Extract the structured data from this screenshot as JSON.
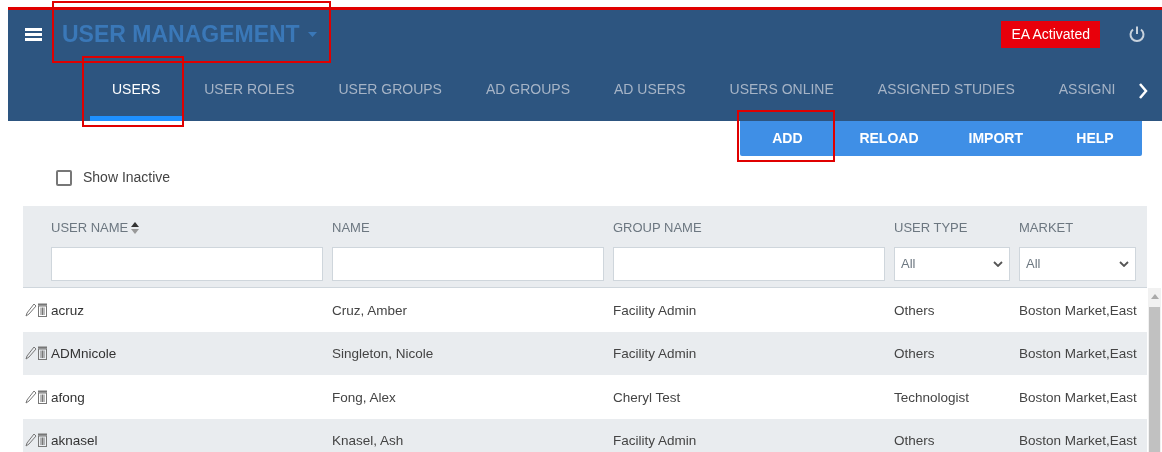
{
  "header": {
    "title": "USER MANAGEMENT",
    "title_highlighted": true,
    "badge": "EA Activated"
  },
  "tabs": [
    {
      "label": "USERS",
      "selected": true,
      "highlighted": true
    },
    {
      "label": "USER ROLES",
      "selected": false,
      "highlighted": false
    },
    {
      "label": "USER GROUPS",
      "selected": false,
      "highlighted": false
    },
    {
      "label": "AD GROUPS",
      "selected": false,
      "highlighted": false
    },
    {
      "label": "AD USERS",
      "selected": false,
      "highlighted": false
    },
    {
      "label": "USERS ONLINE",
      "selected": false,
      "highlighted": false
    },
    {
      "label": "ASSIGNED STUDIES",
      "selected": false,
      "highlighted": false
    },
    {
      "label": "ASSIGNI",
      "selected": false,
      "highlighted": false
    }
  ],
  "toolbar": [
    {
      "label": "ADD",
      "highlighted": true
    },
    {
      "label": "RELOAD",
      "highlighted": false
    },
    {
      "label": "IMPORT",
      "highlighted": false
    },
    {
      "label": "HELP",
      "highlighted": false
    }
  ],
  "show_inactive": {
    "label": "Show Inactive",
    "checked": false
  },
  "table": {
    "columns": [
      {
        "label": "USER NAME",
        "sortable": true,
        "filter": {
          "kind": "text"
        }
      },
      {
        "label": "NAME",
        "sortable": false,
        "filter": {
          "kind": "text"
        }
      },
      {
        "label": "GROUP NAME",
        "sortable": false,
        "filter": {
          "kind": "text"
        }
      },
      {
        "label": "USER TYPE",
        "sortable": false,
        "filter": {
          "kind": "select",
          "value": "All"
        }
      },
      {
        "label": "MARKET",
        "sortable": false,
        "filter": {
          "kind": "select",
          "value": "All"
        }
      }
    ],
    "rows": [
      [
        "acruz",
        "Cruz, Amber",
        "Facility Admin",
        "Others",
        "Boston Market,East"
      ],
      [
        "ADMnicole",
        "Singleton, Nicole",
        "Facility Admin",
        "Others",
        "Boston Market,East"
      ],
      [
        "afong",
        "Fong, Alex",
        "Cheryl Test",
        "Technologist",
        "Boston Market,East"
      ],
      [
        "aknasel",
        "Knasel, Ash",
        "Facility Admin",
        "Others",
        "Boston Market,East"
      ]
    ]
  }
}
